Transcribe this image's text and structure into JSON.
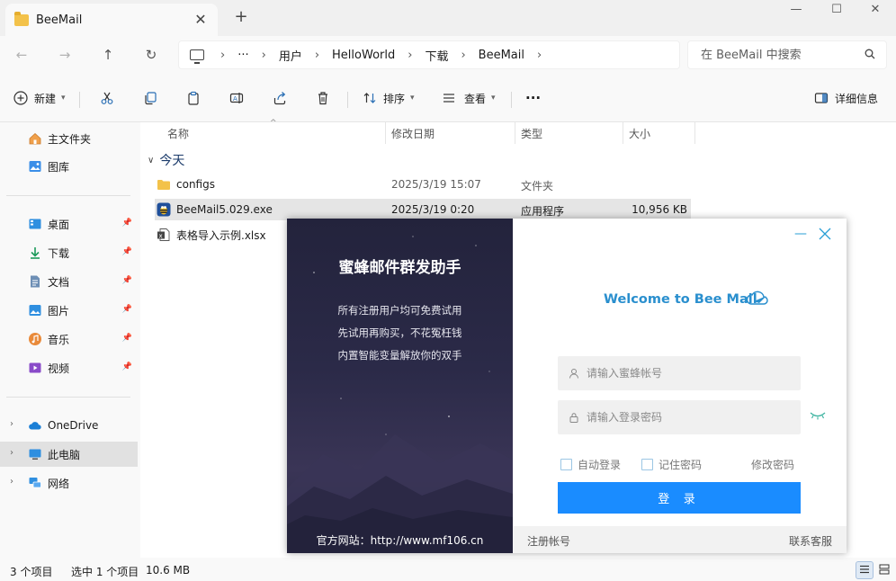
{
  "window": {
    "tab_title": "BeeMail",
    "tab_close": "✕",
    "tab_add": "+",
    "minimize": "—",
    "maximize": "☐",
    "close": "✕"
  },
  "nav": {
    "back": "←",
    "forward": "→",
    "up": "↑",
    "refresh": "↻",
    "more": "···",
    "breadcrumbs": [
      "用户",
      "HelloWorld",
      "下载",
      "BeeMail"
    ],
    "sep": "›",
    "search_placeholder": "在 BeeMail 中搜索"
  },
  "toolbar": {
    "new_label": "新建",
    "sort_label": "排序",
    "view_label": "查看",
    "more": "···",
    "details_label": "详细信息"
  },
  "sidebar": {
    "home": "主文件夹",
    "gallery": "图库",
    "pinned": [
      "桌面",
      "下载",
      "文档",
      "图片",
      "音乐",
      "视频"
    ],
    "onedrive": "OneDrive",
    "this_pc": "此电脑",
    "network": "网络"
  },
  "list": {
    "columns": {
      "name": "名称",
      "date": "修改日期",
      "type": "类型",
      "size": "大小"
    },
    "group": "今天",
    "rows": [
      {
        "name": "configs",
        "date": "2025/3/19 15:07",
        "type": "文件夹",
        "size": ""
      },
      {
        "name": "BeeMail5.029.exe",
        "date": "2025/3/19 0:20",
        "type": "应用程序",
        "size": "10,956 KB"
      },
      {
        "name": "表格导入示例.xlsx",
        "date": "",
        "type": "",
        "size": ""
      }
    ]
  },
  "status": {
    "count": "3 个项目",
    "selected": "选中 1 个项目",
    "size": "10.6 MB"
  },
  "dialog": {
    "app_title": "蜜蜂邮件群发助手",
    "tagline": [
      "所有注册用户均可免费试用",
      "先试用再购买，不花冤枉钱",
      "内置智能变量解放你的双手"
    ],
    "website": "官方网站：http://www.mf106.cn",
    "welcome": "Welcome to Bee Mail",
    "minimize": "—",
    "account_placeholder": "请输入蜜蜂帐号",
    "password_placeholder": "请输入登录密码",
    "auto_login": "自动登录",
    "remember": "记住密码",
    "change_password": "修改密码",
    "login": "登 录",
    "register": "注册帐号",
    "support": "联系客服",
    "accent": "#1a8cff"
  }
}
